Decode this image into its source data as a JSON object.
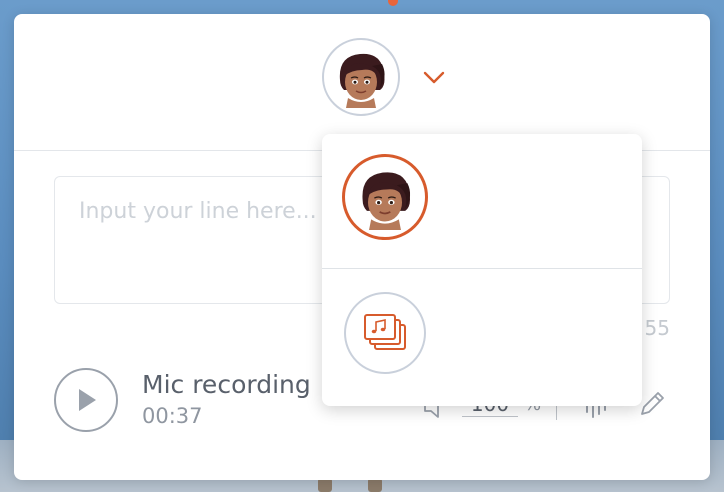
{
  "input": {
    "placeholder": "Input your line here..."
  },
  "char_count": "55",
  "recording": {
    "title": "Mic recording",
    "time": "00:37"
  },
  "volume": {
    "value": "100",
    "unit": "%"
  },
  "colors": {
    "accent": "#d75b2c",
    "text": "#59606b",
    "muted": "#8f96a0",
    "avatar_border": "#c9d0db"
  },
  "icons": {
    "character_avatar": "character-avatar-icon",
    "chevron": "chevron-down-icon",
    "play": "play-icon",
    "volume": "speaker-icon",
    "waveform": "waveform-icon",
    "edit": "pencil-icon",
    "music_library": "music-library-icon"
  }
}
